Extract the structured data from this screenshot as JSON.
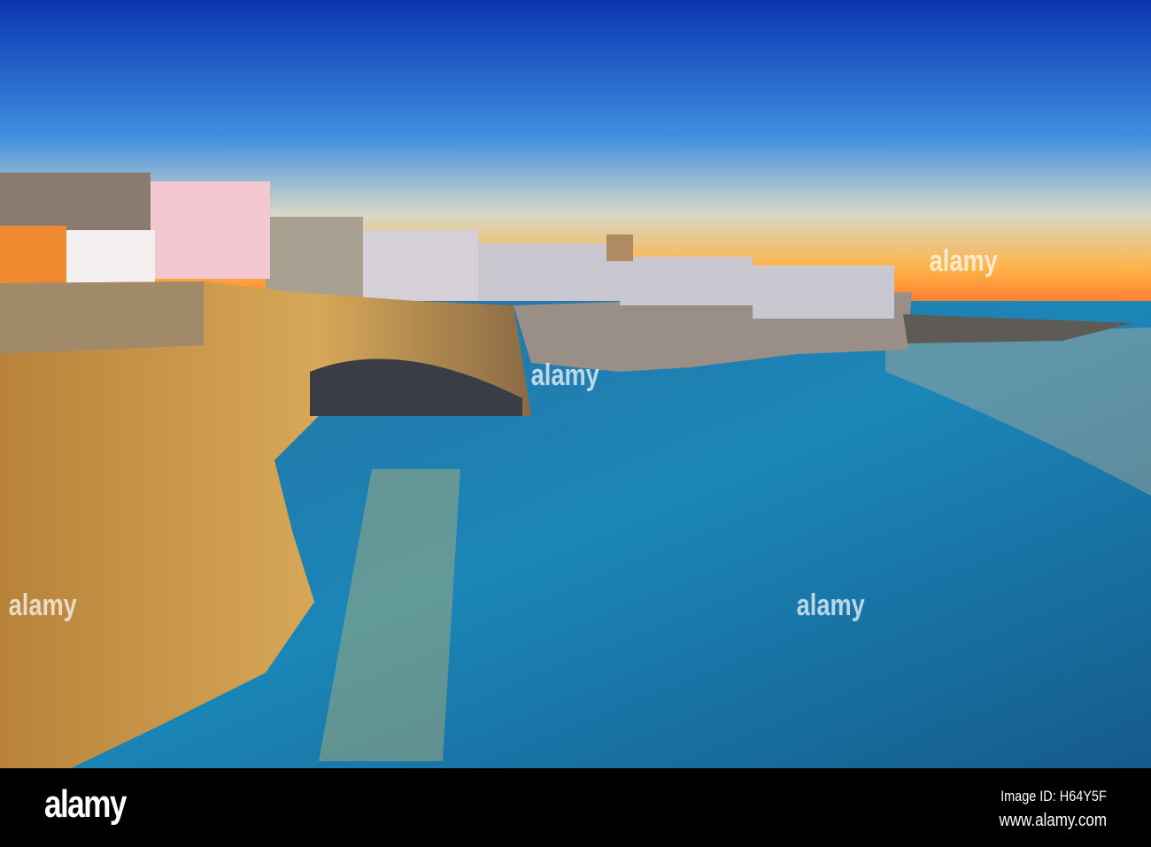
{
  "photo": {
    "subject": "Polignano a Mare coastline at sunset",
    "colors": {
      "sky_top": "#0a3fb8",
      "sky_mid": "#4a9fe0",
      "horizon": "#ff9a3c",
      "sea": "#1a7bb0",
      "cliff": "#c8953e"
    }
  },
  "watermark": {
    "text": "alamy"
  },
  "footer": {
    "logo": "alamy",
    "image_id": "Image ID: H64Y5F",
    "website": "www.alamy.com"
  }
}
